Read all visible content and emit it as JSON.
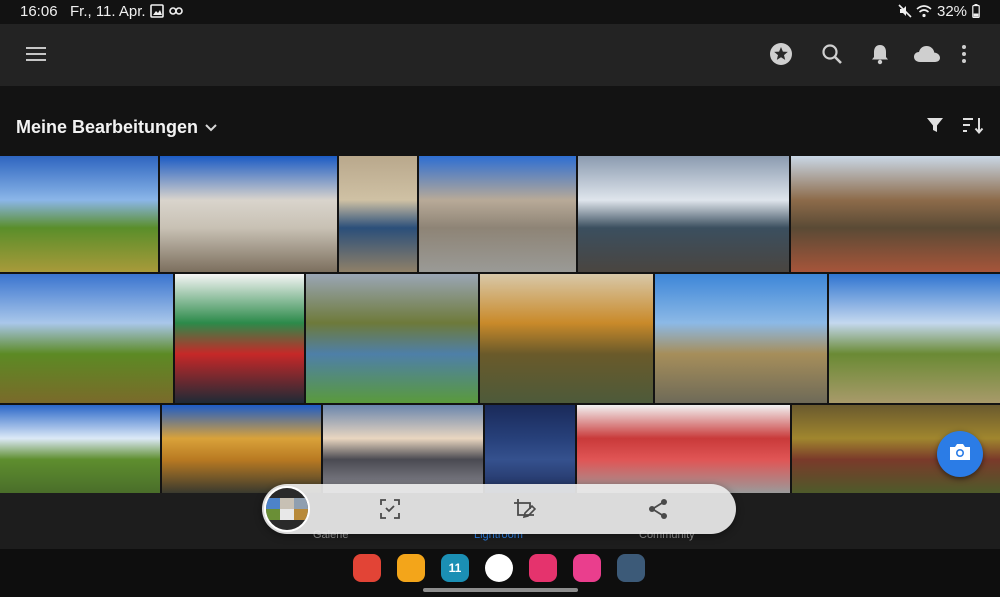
{
  "status_bar": {
    "time": "16:06",
    "date": "Fr., 11. Apr.",
    "battery": "32%",
    "icons": [
      "gallery-icon",
      "link-icon",
      "mute-icon",
      "wifi-icon",
      "battery-icon"
    ]
  },
  "app_bar": {
    "icons": [
      "menu-icon",
      "premium-star-icon",
      "search-icon",
      "notification-bell-icon",
      "cloud-icon",
      "more-vert-icon"
    ]
  },
  "section": {
    "title": "Meine Bearbeitungen",
    "icons": [
      "chevron-down-icon",
      "filter-icon",
      "sort-icon"
    ]
  },
  "photos": [
    {
      "name": "meadow-birches",
      "colors": [
        "#2e65c0",
        "#8bb6e8",
        "#5a8e2a",
        "#a89a3a"
      ]
    },
    {
      "name": "villa-facade",
      "colors": [
        "#1b5bc4",
        "#d9d4cc",
        "#c8c1b4",
        "#7c6f5e"
      ]
    },
    {
      "name": "church-portal",
      "colors": [
        "#b9a88c",
        "#cfc1a4",
        "#2b4f7a",
        "#8f8068"
      ]
    },
    {
      "name": "castle-courtyard",
      "colors": [
        "#2e6ed2",
        "#b8aa98",
        "#8e8476",
        "#9a9a96"
      ]
    },
    {
      "name": "rocky-coast",
      "colors": [
        "#8b9bb0",
        "#dfe5ec",
        "#3b4f5f",
        "#4a4540"
      ]
    },
    {
      "name": "fair-ferris-wheel",
      "colors": [
        "#c9d7e6",
        "#8d6b4a",
        "#5a4a35",
        "#a6553a"
      ]
    },
    {
      "name": "meadow-tree",
      "colors": [
        "#3a74cf",
        "#a9c7ea",
        "#5c8a24",
        "#7a6a2a"
      ]
    },
    {
      "name": "raspberry-pi-kit",
      "colors": [
        "#f5f5f5",
        "#2c8a4a",
        "#c62828",
        "#1f2a36"
      ]
    },
    {
      "name": "river-valley",
      "colors": [
        "#9aa6b5",
        "#6e7a3a",
        "#4e7fa8",
        "#5a9a3c"
      ]
    },
    {
      "name": "autumn-pond",
      "colors": [
        "#d8c8a8",
        "#c98a2a",
        "#6a5a2a",
        "#4d5a3a"
      ]
    },
    {
      "name": "bare-tree-road",
      "colors": [
        "#3d86d8",
        "#8cb9e6",
        "#a68e5a",
        "#6e6a58"
      ]
    },
    {
      "name": "field-path-tree",
      "colors": [
        "#2f74d0",
        "#c4d8ef",
        "#6a8a34",
        "#a89a6a"
      ]
    },
    {
      "name": "single-tree-sky",
      "colors": [
        "#2a67c8",
        "#dce9f7",
        "#5e8e2e",
        "#4a6e2a"
      ]
    },
    {
      "name": "yellow-tree",
      "colors": [
        "#1e5cc6",
        "#d9a23a",
        "#b97a22",
        "#3a3a2e"
      ]
    },
    {
      "name": "town-harbor",
      "colors": [
        "#6a86ad",
        "#e9d6c0",
        "#4a4a52",
        "#8d8d96"
      ]
    },
    {
      "name": "starry-sky",
      "colors": [
        "#1a2a5a",
        "#27407a",
        "#35518e",
        "#20305e"
      ]
    },
    {
      "name": "decal-skin-sheet",
      "colors": [
        "#f2f2f2",
        "#c93a3a",
        "#e05555",
        "#9a9a9a"
      ]
    },
    {
      "name": "autumn-leaves",
      "colors": [
        "#6a5a2e",
        "#a0862e",
        "#7a3a2a",
        "#4e5a2a"
      ]
    }
  ],
  "fab": {
    "icon": "camera-icon"
  },
  "bottom_nav": {
    "items": [
      {
        "label": "Galerie",
        "icon": "gallery-icon"
      },
      {
        "label": "Lightroom",
        "icon": "lightroom-cloud-icon"
      },
      {
        "label": "Community",
        "icon": "community-globe-icon"
      }
    ]
  },
  "overlay_toolbar": {
    "icons": [
      "scan-icon",
      "edit-crop-icon",
      "share-icon"
    ]
  },
  "dock": {
    "apps": [
      {
        "name": "notes-app",
        "color": "#e24436"
      },
      {
        "name": "files-app",
        "color": "#f3a51a"
      },
      {
        "name": "calendar-app",
        "color": "#1b8fb4",
        "text": "11"
      },
      {
        "name": "messages-app",
        "color": "#ffffff"
      },
      {
        "name": "camera-app",
        "color": "#e5336d"
      },
      {
        "name": "store-app",
        "color": "#ea3e8d"
      },
      {
        "name": "apps-grid",
        "color": "#3c5a78"
      }
    ]
  }
}
